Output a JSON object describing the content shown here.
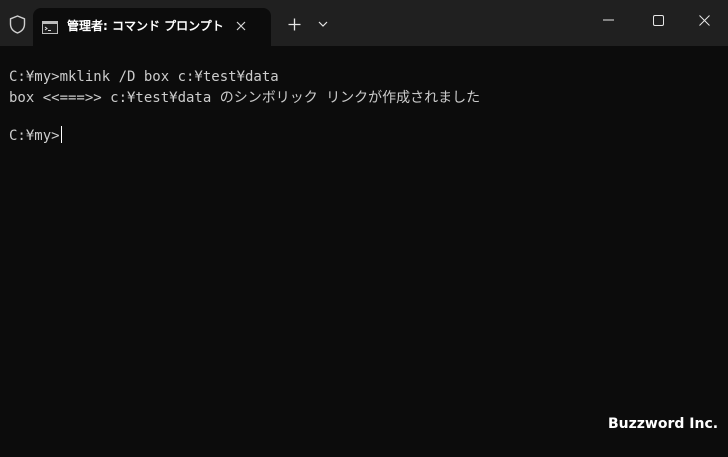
{
  "window": {
    "tab_title": "管理者: コマンド プロンプト",
    "tab_icon": "cmd-icon",
    "shield_icon": "shield-icon",
    "new_tab_icon": "plus-icon",
    "dropdown_icon": "chevron-down-icon",
    "minimize_icon": "minimize-icon",
    "maximize_icon": "maximize-icon",
    "close_icon": "close-icon"
  },
  "terminal": {
    "lines": [
      "C:¥my>mklink /D box c:¥test¥data",
      "box <<===>> c:¥test¥data のシンボリック リンクが作成されました",
      ""
    ],
    "prompt": "C:¥my>"
  },
  "watermark": "Buzzword Inc.",
  "colors": {
    "titlebar_bg": "#202020",
    "terminal_bg": "#0c0c0c",
    "text": "#cccccc"
  }
}
